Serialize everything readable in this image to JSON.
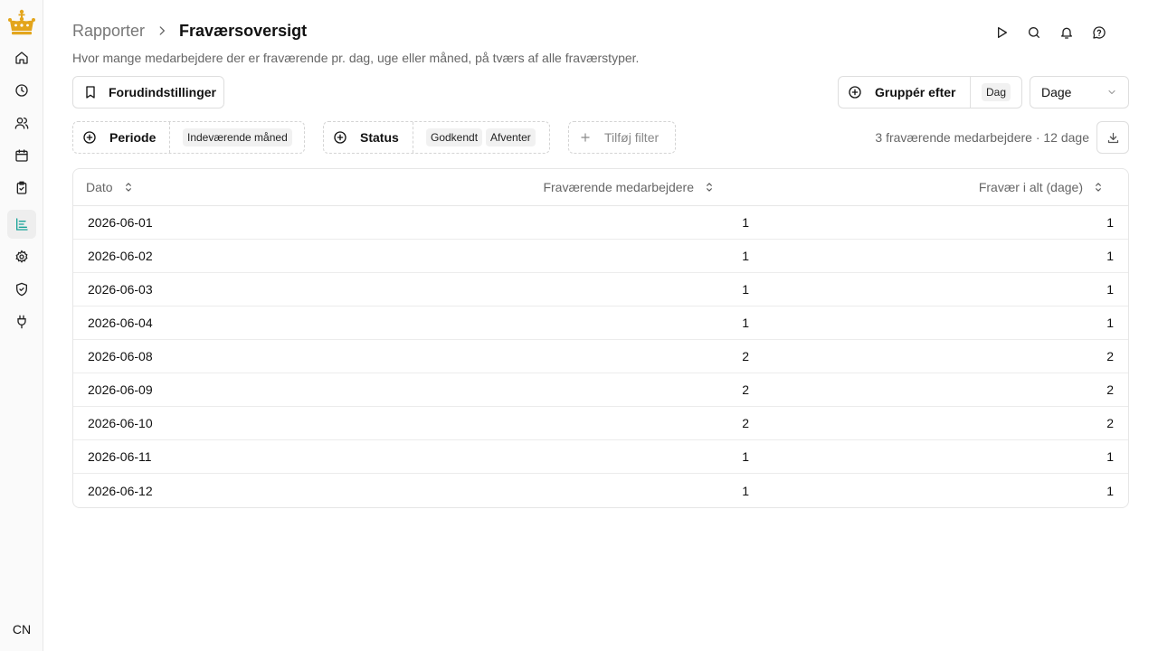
{
  "sidebar": {
    "nav": [
      {
        "name": "home"
      },
      {
        "name": "time"
      },
      {
        "name": "users"
      },
      {
        "name": "calendar"
      },
      {
        "name": "tasks"
      },
      {
        "name": "reports",
        "active": true
      },
      {
        "name": "settings"
      },
      {
        "name": "security"
      },
      {
        "name": "integrations"
      }
    ],
    "avatar_initials": "CN",
    "accent_color": "#17a398",
    "logo_color": "#e3a51c"
  },
  "header": {
    "breadcrumb_parent": "Rapporter",
    "title": "Fraværsoversigt",
    "subtitle": "Hvor mange medarbejdere der er fraværende pr. dag, uge eller måned, på tværs af alle fraværstyper."
  },
  "toolbar": {
    "presets_label": "Forudindstillinger",
    "group_by_label": "Gruppér efter",
    "group_by_value": "Dag",
    "unit_select_value": "Dage"
  },
  "filters": {
    "period_label": "Periode",
    "period_value": "Indeværende måned",
    "status_label": "Status",
    "status_values": [
      "Godkendt",
      "Afventer"
    ],
    "add_filter_label": "Tilføj filter"
  },
  "summary": "3 fraværende medarbejdere · 12 dage",
  "table": {
    "columns": [
      "Dato",
      "Fraværende medarbejdere",
      "Fravær i alt (dage)"
    ],
    "rows": [
      [
        "2026-06-01",
        "1",
        "1"
      ],
      [
        "2026-06-02",
        "1",
        "1"
      ],
      [
        "2026-06-03",
        "1",
        "1"
      ],
      [
        "2026-06-04",
        "1",
        "1"
      ],
      [
        "2026-06-08",
        "2",
        "2"
      ],
      [
        "2026-06-09",
        "2",
        "2"
      ],
      [
        "2026-06-10",
        "2",
        "2"
      ],
      [
        "2026-06-11",
        "1",
        "1"
      ],
      [
        "2026-06-12",
        "1",
        "1"
      ]
    ]
  }
}
